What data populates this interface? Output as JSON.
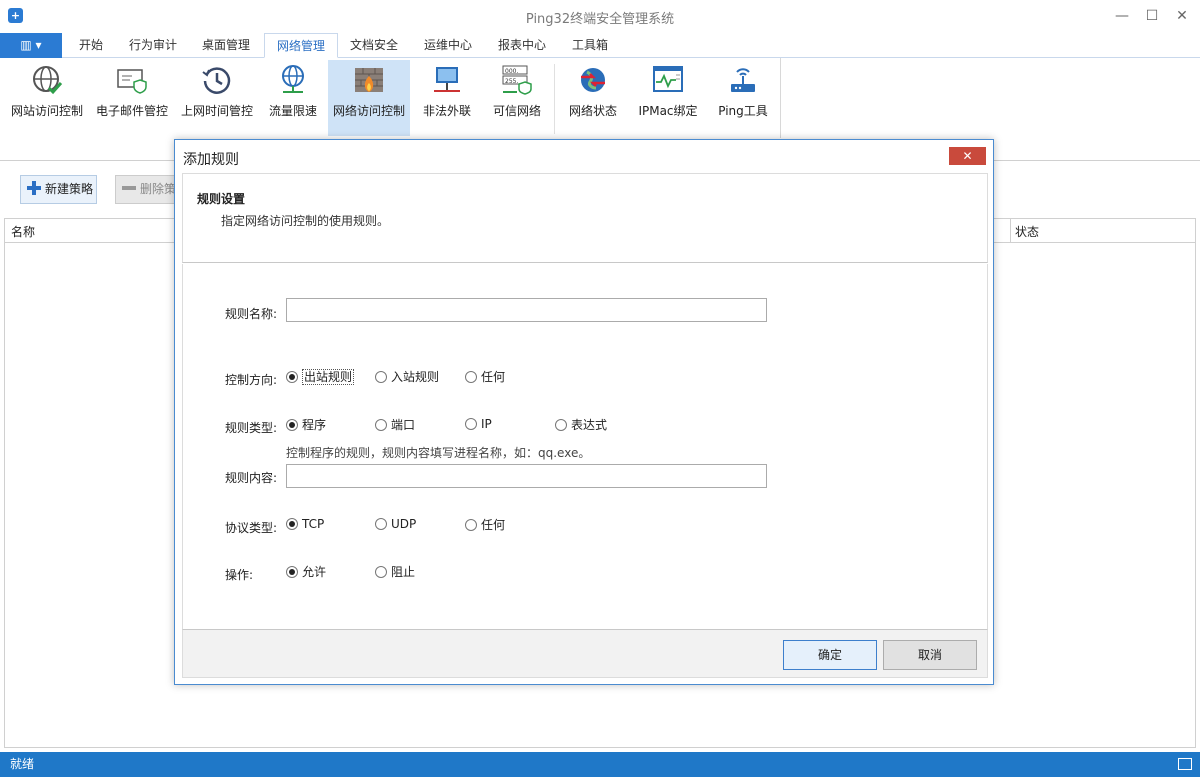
{
  "window": {
    "title": "Ping32终端安全管理系统",
    "minimize": "—",
    "maximize": "☐",
    "close": "✕"
  },
  "menu": {
    "app_button": "▥ ▾",
    "tabs": [
      "开始",
      "行为审计",
      "桌面管理",
      "网络管理",
      "文档安全",
      "运维中心",
      "报表中心",
      "工具箱"
    ],
    "active_tab": "网络管理"
  },
  "ribbon": {
    "items": [
      {
        "label": "网站访问控制",
        "icon": "globe-check-icon"
      },
      {
        "label": "电子邮件管控",
        "icon": "mail-shield-icon"
      },
      {
        "label": "上网时间管控",
        "icon": "clock-history-icon"
      },
      {
        "label": "流量限速",
        "icon": "globe-network-icon"
      },
      {
        "label": "网络访问控制",
        "icon": "firewall-icon"
      },
      {
        "label": "非法外联",
        "icon": "monitor-network-icon"
      },
      {
        "label": "可信网络",
        "icon": "ip-shield-icon"
      },
      {
        "label": "网络状态",
        "icon": "globe-arrows-icon"
      },
      {
        "label": "IPMac绑定",
        "icon": "monitor-chart-icon"
      },
      {
        "label": "Ping工具",
        "icon": "router-icon"
      }
    ],
    "active_item": "网络访问控制"
  },
  "toolbar": {
    "new_policy": "新建策略",
    "delete_policy": "删除策"
  },
  "grid": {
    "columns": [
      "名称",
      "状态"
    ]
  },
  "statusbar": {
    "text": "就绪"
  },
  "dialog": {
    "title": "添加规则",
    "close_label": "✕",
    "header_title": "规则设置",
    "header_desc": "指定网络访问控制的使用规则。",
    "fields": {
      "rule_name_label": "规则名称:",
      "rule_name_value": "",
      "direction_label": "控制方向:",
      "direction_options": [
        "出站规则",
        "入站规则",
        "任何"
      ],
      "direction_selected": "出站规则",
      "type_label": "规则类型:",
      "type_options": [
        "程序",
        "端口",
        "IP",
        "表达式"
      ],
      "type_selected": "程序",
      "hint": "控制程序的规则，规则内容填写进程名称，如：qq.exe。",
      "content_label": "规则内容:",
      "content_value": "",
      "protocol_label": "协议类型:",
      "protocol_options": [
        "TCP",
        "UDP",
        "任何"
      ],
      "protocol_selected": "TCP",
      "action_label": "操作:",
      "action_options": [
        "允许",
        "阻止"
      ],
      "action_selected": "允许"
    },
    "ok_button": "确定",
    "cancel_button": "取消"
  },
  "colors": {
    "accent": "#2b7bd3",
    "statusbar": "#1f78c8",
    "ribbon_active": "#cfe3f7",
    "close_red": "#c94a3c"
  }
}
